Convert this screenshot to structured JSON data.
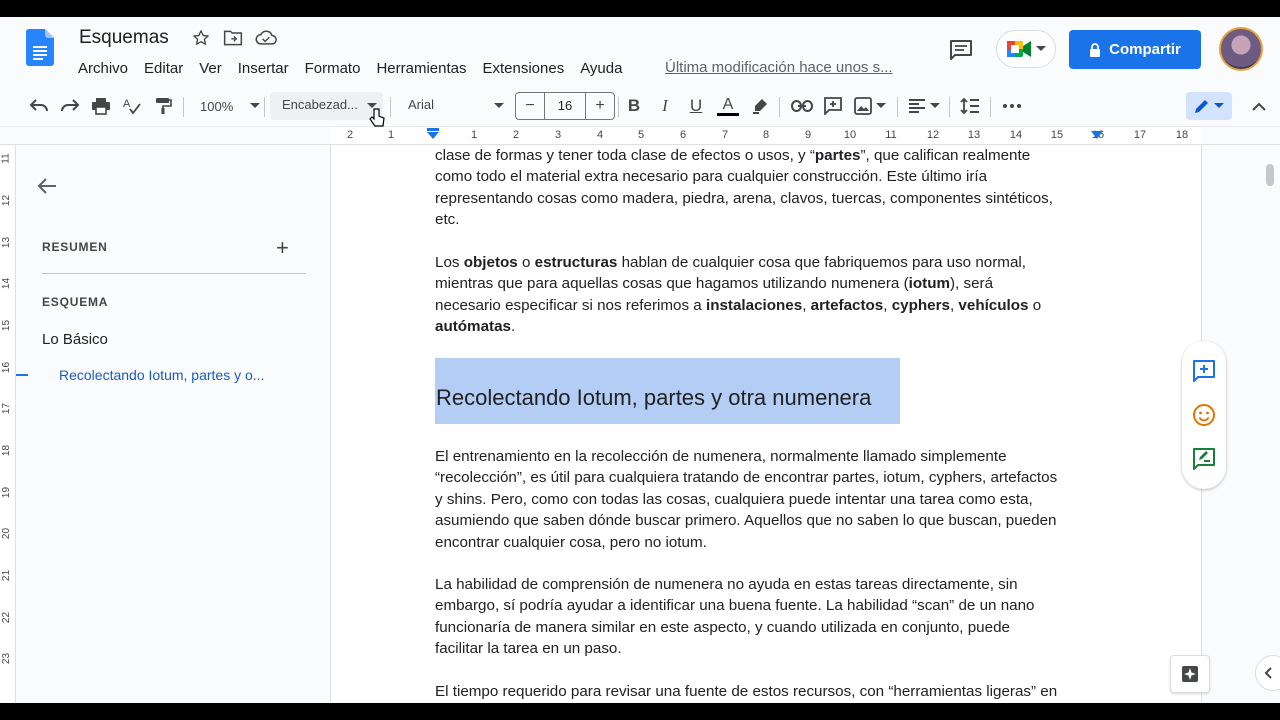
{
  "header": {
    "title": "Esquemas",
    "menu": [
      "Archivo",
      "Editar",
      "Ver",
      "Insertar",
      "Formato",
      "Herramientas",
      "Extensiones",
      "Ayuda"
    ],
    "last_modified": "Última modificación hace unos s...",
    "share_label": "Compartir"
  },
  "toolbar": {
    "zoom": "100%",
    "style": "Encabezad...",
    "font": "Arial",
    "font_size": "16"
  },
  "ruler": {
    "numbers": [
      "2",
      "1",
      "1",
      "2",
      "3",
      "4",
      "5",
      "6",
      "7",
      "8",
      "9",
      "10",
      "11",
      "12",
      "13",
      "14",
      "15",
      "16",
      "17",
      "18"
    ]
  },
  "vruler": {
    "numbers": [
      "11",
      "12",
      "13",
      "14",
      "15",
      "16",
      "17",
      "18",
      "19",
      "20",
      "21",
      "22",
      "23"
    ]
  },
  "outline": {
    "summary_title": "RESUMEN",
    "outline_title": "ESQUEMA",
    "items": [
      {
        "label": "Lo Básico",
        "level": 1
      },
      {
        "label": "Recolectando Iotum, partes y o...",
        "level": 2
      }
    ]
  },
  "document": {
    "para1_lines": [
      "clase de formas y tener toda clase de efectos o usos, y “<b>partes</b>”, que califican realmente",
      "como todo el material extra necesario para cualquier construcción. Este último iría",
      "representando cosas como madera, piedra, arena, clavos, tuercas, componentes sintéticos,",
      "etc."
    ],
    "para2_lines": [
      "Los <b>objetos</b> o <b>estructuras</b> hablan de cualquier cosa que fabriquemos para uso normal,",
      "mientras que para aquellas cosas que hagamos utilizando numenera (<b>iotum</b>), será",
      "necesario especificar si nos referimos a <b>instalaciones</b>, <b>artefactos</b>, <b>cyphers</b>, <b>vehículos</b> o",
      "<b>autómatas</b>."
    ],
    "heading": "Recolectando Iotum, partes y otra numenera",
    "para3_lines": [
      "El entrenamiento en la recolección de numenera, normalmente llamado simplemente",
      "“recolección”, es útil para cualquiera tratando de encontrar partes, iotum, cyphers, artefactos",
      "y shins. Pero, como con todas las cosas, cualquiera puede intentar una tarea como esta,",
      "asumiendo que saben dónde buscar primero. Aquellos que no saben lo que buscan, pueden",
      "encontrar cualquier cosa, pero no iotum."
    ],
    "para4_lines": [
      "La habilidad de comprensión de numenera no ayuda en estas tareas directamente, sin",
      "embargo, sí podría ayudar a identificar una buena fuente. La habilidad “scan” de un nano",
      "funcionaría de manera similar en este aspecto, y cuando utilizada en conjunto, puede",
      "facilitar la tarea en un paso."
    ],
    "para5_lines": [
      "El tiempo requerido para revisar una fuente de estos recursos, con “herramientas ligeras” en"
    ]
  },
  "colors": {
    "accent": "#1a73e8",
    "selection": "#b4cdf4",
    "background": "#f9fbfd"
  }
}
